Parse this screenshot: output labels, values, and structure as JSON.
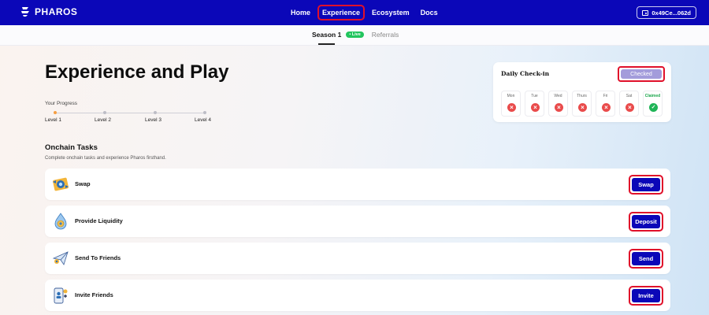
{
  "header": {
    "brand": "PHAROS",
    "nav": [
      "Home",
      "Experience",
      "Ecosystem",
      "Docs"
    ],
    "active_nav": "Experience",
    "wallet": "0x49Ce...062d"
  },
  "subnav": {
    "season": "Season 1",
    "live_badge": "• Live",
    "referrals": "Referrals"
  },
  "hero": {
    "title": "Experience and Play",
    "progress_label": "Your Progress",
    "levels": [
      "Level 1",
      "Level 2",
      "Level 3",
      "Level 4"
    ],
    "current_level_index": 0
  },
  "tasks_section": {
    "title": "Onchain Tasks",
    "subtitle": "Complete onchain tasks and experience Pharos firsthand."
  },
  "checkin": {
    "title": "Daily Check-in",
    "button": "Checked",
    "days": [
      {
        "name": "Mon",
        "status": "missed"
      },
      {
        "name": "Tue",
        "status": "missed"
      },
      {
        "name": "Wed",
        "status": "missed"
      },
      {
        "name": "Thurs",
        "status": "missed"
      },
      {
        "name": "Fri",
        "status": "missed"
      },
      {
        "name": "Sat",
        "status": "missed"
      },
      {
        "name": "Claimed",
        "status": "claimed"
      }
    ]
  },
  "tasks": [
    {
      "label": "Swap",
      "button": "Swap",
      "icon": "swap-icon"
    },
    {
      "label": "Provide Liquidity",
      "button": "Deposit",
      "icon": "liquidity-drop-icon"
    },
    {
      "label": "Send To Friends",
      "button": "Send",
      "icon": "paper-plane-icon"
    },
    {
      "label": "Invite Friends",
      "button": "Invite",
      "icon": "invite-phone-icon"
    }
  ],
  "colors": {
    "primary": "#0b07b8",
    "highlight": "#e0102a",
    "checked_button": "#a39cdb",
    "missed": "#e94b4b",
    "claimed": "#1fb457",
    "progress_active": "#f59e42"
  }
}
